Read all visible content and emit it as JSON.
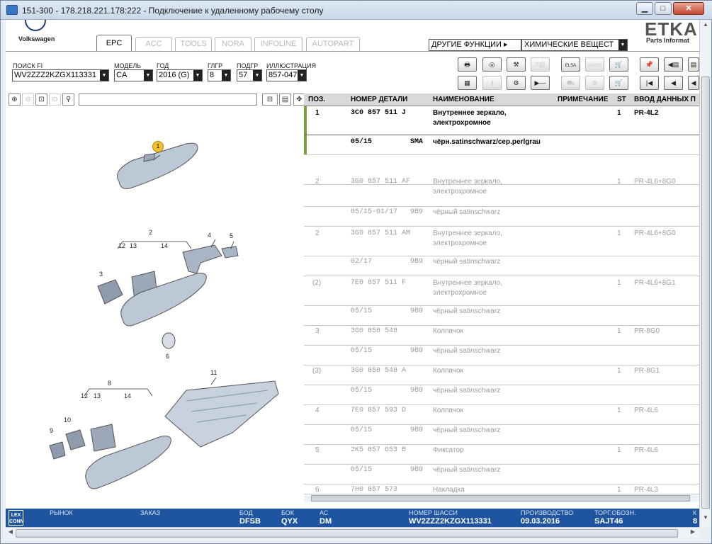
{
  "window": {
    "title": "151-300 - 178.218.221.178:222 - Подключение к удаленному рабочему столу",
    "btn_min": "▁",
    "btn_max": "□",
    "btn_close": "✕"
  },
  "brand": {
    "vw": "Volkswagen",
    "etka": "ETKA",
    "etka_sub": "Parts Informat"
  },
  "tabs": [
    "EPC",
    "ACC",
    "TOOLS",
    "NORA",
    "INFOLINE",
    "AUTOPART"
  ],
  "other_functions": "ДРУГИЕ ФУНКЦИИ ▸",
  "chemicals_select": "ХИМИЧЕСКИЕ ВЕЩЕСТ",
  "filters": {
    "fi_label": "ПОИСК FI",
    "fi_value": "WV2ZZZ2KZGX113331",
    "model_label": "МОДЕЛЬ",
    "model_value": "CA",
    "year_label": "ГОД",
    "year_value": "2016 (G)",
    "hg_label": "ГЛГР",
    "hg_value": "8",
    "sub_label": "ПОДГР",
    "sub_value": "57",
    "ill_label": "ИЛЛЮСТРАЦИЯ",
    "ill_value": "857-047"
  },
  "toolbar": {
    "elsa": "ELSA",
    "depot": "DEPOT"
  },
  "table": {
    "headers": {
      "pos": "ПОЗ.",
      "part": "НОМЕР ДЕТАЛИ",
      "name": "НАИМЕНОВАНИЕ",
      "note": "ПРИМЕЧАНИЕ",
      "st": "ST",
      "input": "ВВОД ДАННЫХ П"
    },
    "rows": [
      {
        "pos": "1",
        "part": "3C0  857  511  J",
        "name": "Внутреннее зеркало,",
        "name2": "электрохромное",
        "st": "1",
        "input": "PR-4L2"
      },
      {
        "pos": "",
        "part": "05/15",
        "code": "SMA",
        "name": "чёрн.satinschwarz/сер.perlgrau",
        "name2": "",
        "st": "",
        "input": ""
      },
      {
        "pos": "2",
        "part": "3G0  857  511  AF",
        "name": "Внутреннее зеркало,",
        "name2": "электрохромное",
        "st": "1",
        "input": "PR-4L6+8G0"
      },
      {
        "pos": "",
        "part": "05/15-01/17",
        "code": "9B9",
        "name": "чёрный satinschwarz",
        "name2": "",
        "st": "",
        "input": ""
      },
      {
        "pos": "2",
        "part": "3G0  857  511  AM",
        "name": "Внутреннее зеркало,",
        "name2": "электрохромное",
        "st": "1",
        "input": "PR-4L6+8G0"
      },
      {
        "pos": "",
        "part": "02/17",
        "code": "9B9",
        "name": "чёрный satinschwarz",
        "name2": "",
        "st": "",
        "input": ""
      },
      {
        "pos": "(2)",
        "part": "7E0  857  511  F",
        "name": "Внутреннее зеркало,",
        "name2": "электрохромное",
        "st": "1",
        "input": "PR-4L6+8G1"
      },
      {
        "pos": "",
        "part": "05/15",
        "code": "9B9",
        "name": "чёрный satinschwarz",
        "name2": "",
        "st": "",
        "input": ""
      },
      {
        "pos": "3",
        "part": "3G0  858  548",
        "name": "Колпачок",
        "name2": "",
        "st": "1",
        "input": "PR-8G0"
      },
      {
        "pos": "",
        "part": "05/15",
        "code": "9B9",
        "name": "чёрный satinschwarz",
        "name2": "",
        "st": "",
        "input": ""
      },
      {
        "pos": "(3)",
        "part": "3G0  858  548  A",
        "name": "Колпачок",
        "name2": "",
        "st": "1",
        "input": "PR-8G1"
      },
      {
        "pos": "",
        "part": "05/15",
        "code": "9B9",
        "name": "чёрный satinschwarz",
        "name2": "",
        "st": "",
        "input": ""
      },
      {
        "pos": "4",
        "part": "7E0  857  593  D",
        "name": "Колпачок",
        "name2": "",
        "st": "1",
        "input": "PR-4L6"
      },
      {
        "pos": "",
        "part": "05/15",
        "code": "9B9",
        "name": "чёрный satinschwarz",
        "name2": "",
        "st": "",
        "input": ""
      },
      {
        "pos": "5",
        "part": "2K5  857  653  B",
        "name": "Фиксатор",
        "name2": "",
        "st": "1",
        "input": "PR-4L6"
      },
      {
        "pos": "",
        "part": "05/15",
        "code": "9B9",
        "name": "чёрный satinschwarz",
        "name2": "",
        "st": "",
        "input": ""
      },
      {
        "pos": "6",
        "part": "7H0  857  573",
        "name": "Накладка",
        "name2": "",
        "st": "1",
        "input": "PR-4L3"
      }
    ]
  },
  "illustration": {
    "callouts": [
      "1",
      "2",
      "3",
      "4",
      "5",
      "6",
      "8",
      "9",
      "10",
      "11",
      "12",
      "13",
      "14",
      "12",
      "13",
      "14"
    ]
  },
  "status": {
    "lex_line1": "LEX",
    "lex_line2": "CONN",
    "market_label": "РЫНОК",
    "order_label": "ЗАКАЗ",
    "bod_label": "БОД",
    "bod_value": "DFSB",
    "box_label": "БОК",
    "box_value": "QYX",
    "ac_label": "АС",
    "ac_value": "DM",
    "chassis_label": "НОМЕР ШАССИ",
    "chassis_value": "WV2ZZZ2KZGX113331",
    "prod_label": "ПРОИЗВОДСТВО",
    "prod_value": "09.03.2016",
    "trade_label": "ТОРГ.ОБОЗН.",
    "trade_value": "SAJT46",
    "k_label": "К",
    "k_value": "8"
  },
  "colors": {
    "status_bg": "#1f55a0",
    "selection_bar": "#7da23a",
    "pin": "#f2c02c"
  }
}
